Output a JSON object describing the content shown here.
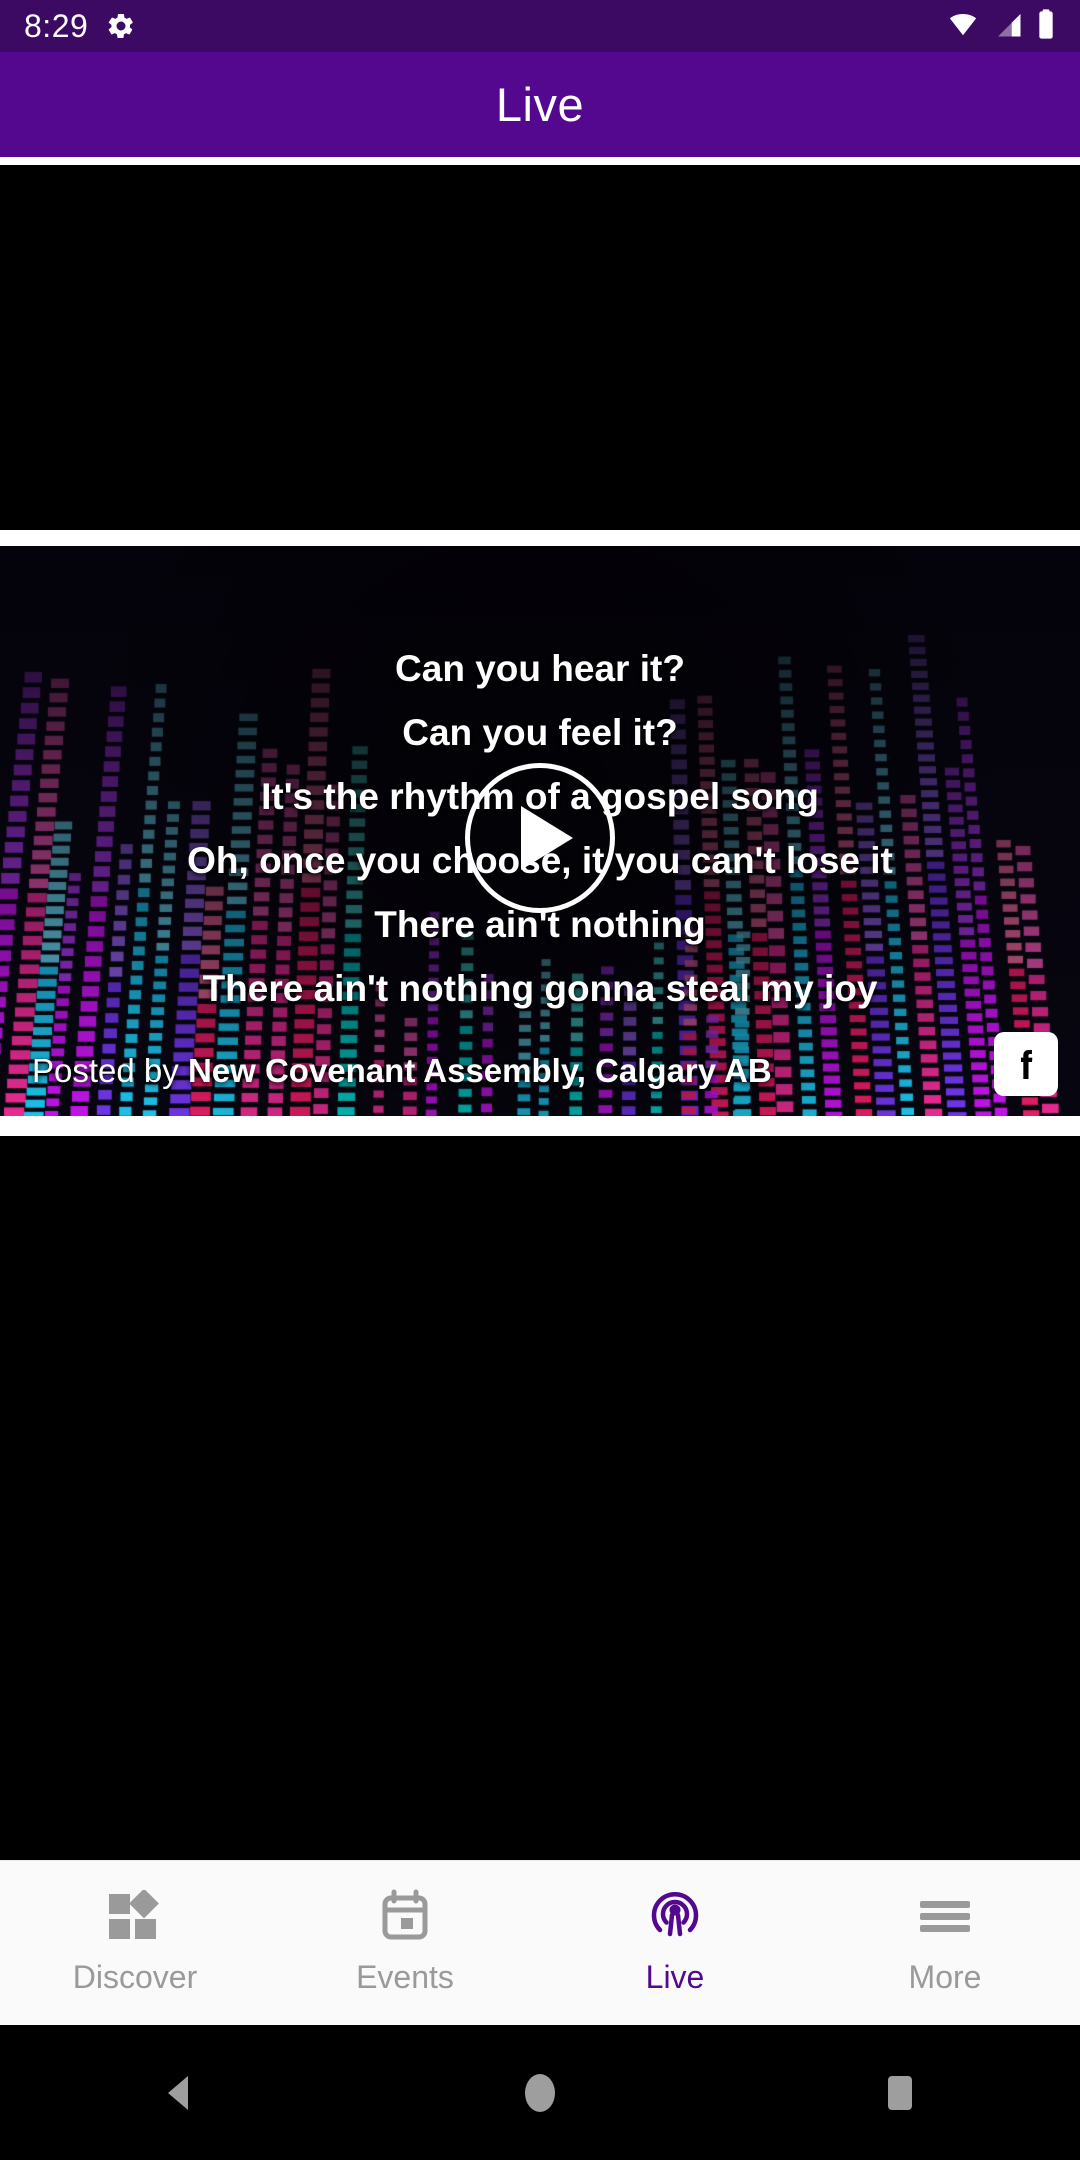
{
  "status_bar": {
    "time": "8:29",
    "gear_icon": "gear-icon",
    "wifi_icon": "wifi-icon",
    "signal_icon": "signal-icon",
    "battery_icon": "battery-icon",
    "background": "#3d0a63"
  },
  "app_bar": {
    "title": "Live",
    "background": "#53088f",
    "text_color": "#ffffff"
  },
  "feed": {
    "video_card": {
      "play_button": "play-icon",
      "lyrics": [
        "Can you hear it?",
        "Can you feel it?",
        "It's the rhythm of a gospel song",
        "Oh, once you choose, it you can't lose it",
        "There ain't nothing",
        "There ain't nothing gonna steal my joy"
      ],
      "posted_by_prefix": "Posted by",
      "posted_by_name": "New Covenant Assembly, Calgary AB",
      "source_icon": "facebook-icon"
    }
  },
  "bottom_nav": {
    "active_color": "#53088f",
    "inactive_color": "#9a9a9a",
    "items": [
      {
        "label": "Discover",
        "icon": "dashboard-icon",
        "active": false
      },
      {
        "label": "Events",
        "icon": "calendar-icon",
        "active": false
      },
      {
        "label": "Live",
        "icon": "broadcast-icon",
        "active": true
      },
      {
        "label": "More",
        "icon": "menu-icon",
        "active": false
      }
    ]
  },
  "android_nav": {
    "back": "back-triangle-icon",
    "home": "home-circle-icon",
    "recents": "recents-square-icon"
  }
}
